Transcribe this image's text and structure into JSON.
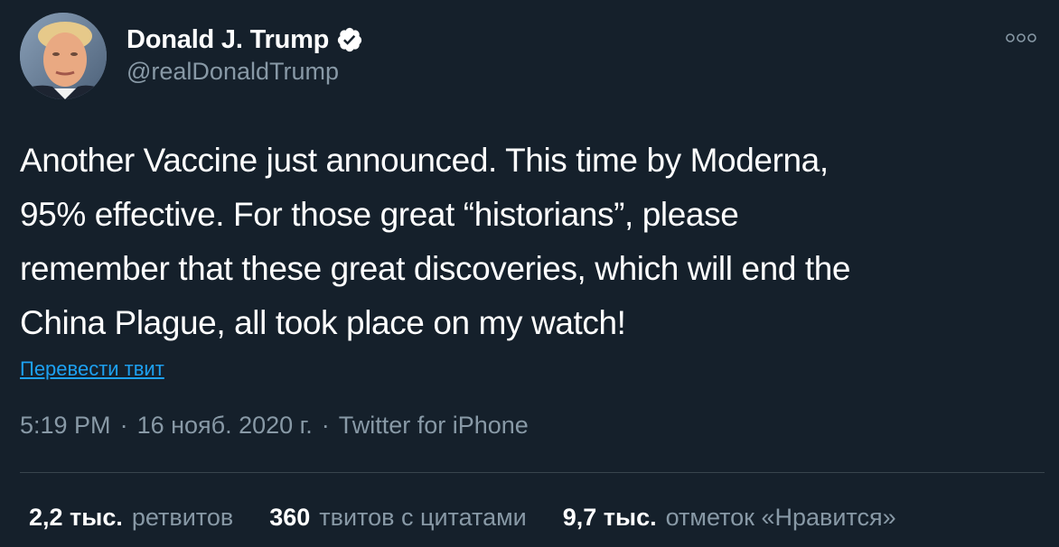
{
  "author": {
    "name": "Donald J. Trump",
    "handle": "@realDonaldTrump",
    "verified": true,
    "avatar_icon": "profile-photo"
  },
  "tweet": {
    "text": "Another Vaccine just announced. This time by Moderna,\n95% effective. For those great “historians”, please\nremember that these great discoveries, which will end the\nChina Plague, all took place on my watch!",
    "translate_label": "Перевести твит"
  },
  "meta": {
    "time": "5:19 PM",
    "date": "16 нояб. 2020 г.",
    "source": "Twitter for iPhone",
    "separator": "·"
  },
  "stats": {
    "retweets": {
      "count": "2,2 тыс.",
      "label": "ретвитов"
    },
    "quotes": {
      "count": "360",
      "label": "твитов с цитатами"
    },
    "likes": {
      "count": "9,7 тыс.",
      "label": "отметок «Нравится»"
    }
  },
  "colors": {
    "background": "#15202b",
    "text": "#ffffff",
    "muted": "#8899a6",
    "link": "#1da1f2",
    "divider": "#38444d"
  },
  "icons": {
    "verified": "verified-badge-icon",
    "more": "more-options-icon"
  }
}
